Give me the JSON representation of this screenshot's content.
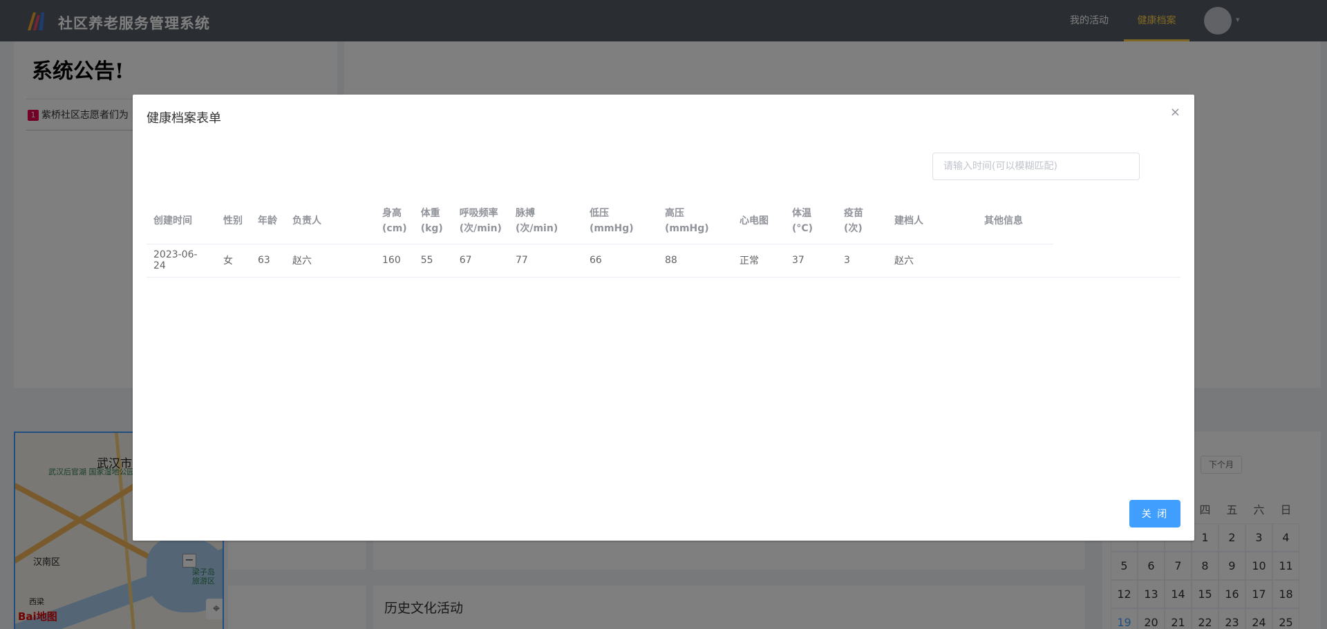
{
  "header": {
    "app_title": "社区养老服务管理系统",
    "nav": [
      {
        "label": "我的活动"
      },
      {
        "label": "健康档案",
        "active": true
      }
    ],
    "accent_color": "#ffd04b",
    "background_color": "#545c64"
  },
  "notice": {
    "title": "系统公告!",
    "items": [
      {
        "index": "1",
        "text": "紫桥社区志愿者们为"
      }
    ]
  },
  "map": {
    "city": "武汉市",
    "district": "汉南区",
    "poi_1": "武汉后官湖 国家湿地公园",
    "poi_2": "梁子岛 旅游区",
    "small_label": "西梁",
    "logo": "Bai地图",
    "zoom_out": "−"
  },
  "history": {
    "title": "历史文化活动"
  },
  "calendar": {
    "next_month": "下个月",
    "weekdays_visible": [
      "四",
      "五",
      "六",
      "日"
    ],
    "rows": [
      [
        "",
        "",
        "",
        "1",
        "2",
        "3",
        "4"
      ],
      [
        "5",
        "6",
        "7",
        "8",
        "9",
        "10",
        "11"
      ],
      [
        "12",
        "13",
        "14",
        "15",
        "16",
        "17",
        "18"
      ],
      [
        "19",
        "20",
        "21",
        "22",
        "23",
        "24",
        "25"
      ]
    ],
    "today": "19"
  },
  "modal": {
    "title": "健康档案表单",
    "close_icon": "×",
    "search_placeholder": "请输入时间(可以模糊匹配)",
    "close_button": "关 闭",
    "columns": [
      "创建时间",
      "性别",
      "年龄",
      "负责人",
      "身高\n(cm)",
      "体重\n(kg)",
      "呼吸频率\n(次/min)",
      "脉搏(次/min)",
      "低压(mmHg)",
      "高压(mmHg)",
      "心电图",
      "体温(°C)",
      "疫苗(次)",
      "建档人",
      "其他信息"
    ],
    "rows": [
      [
        "2023-06-24",
        "女",
        "63",
        "赵六",
        "160",
        "55",
        "67",
        "77",
        "66",
        "88",
        "正常",
        "37",
        "3",
        "赵六",
        ""
      ]
    ]
  }
}
